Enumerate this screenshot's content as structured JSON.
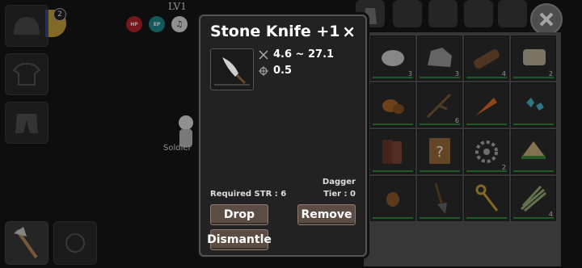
{
  "hud": {
    "level": "LV1",
    "badge_count": "2",
    "ep_label": "EP",
    "npc_name": "Soldier"
  },
  "popup": {
    "title": "Stone Knife +1",
    "close_label": "×",
    "damage": "4.6 ~ 27.1",
    "speed": "0.5",
    "type": "Dagger",
    "required": "Required STR : 6",
    "tier": "Tier : 0",
    "buttons": {
      "drop": "Drop",
      "remove": "Remove",
      "dismantle": "Dismantle"
    }
  },
  "inventory": {
    "items": [
      {
        "icon": "stone-icon",
        "count": "3"
      },
      {
        "icon": "rock-icon",
        "count": "3"
      },
      {
        "icon": "log-icon",
        "count": "4"
      },
      {
        "icon": "scroll-icon",
        "count": "2"
      },
      {
        "icon": "potato-icon",
        "count": ""
      },
      {
        "icon": "branch-icon",
        "count": "6"
      },
      {
        "icon": "carrot-icon",
        "count": ""
      },
      {
        "icon": "gem-ore-icon",
        "count": ""
      },
      {
        "icon": "bark-icon",
        "count": ""
      },
      {
        "icon": "unknown-item-icon",
        "count": ""
      },
      {
        "icon": "gear-icon",
        "count": "2"
      },
      {
        "icon": "sandwich-icon",
        "count": ""
      },
      {
        "icon": "nut-icon",
        "count": ""
      },
      {
        "icon": "shovel-icon",
        "count": ""
      },
      {
        "icon": "key-icon",
        "count": ""
      },
      {
        "icon": "fiber-bundle-icon",
        "count": "4"
      }
    ]
  }
}
